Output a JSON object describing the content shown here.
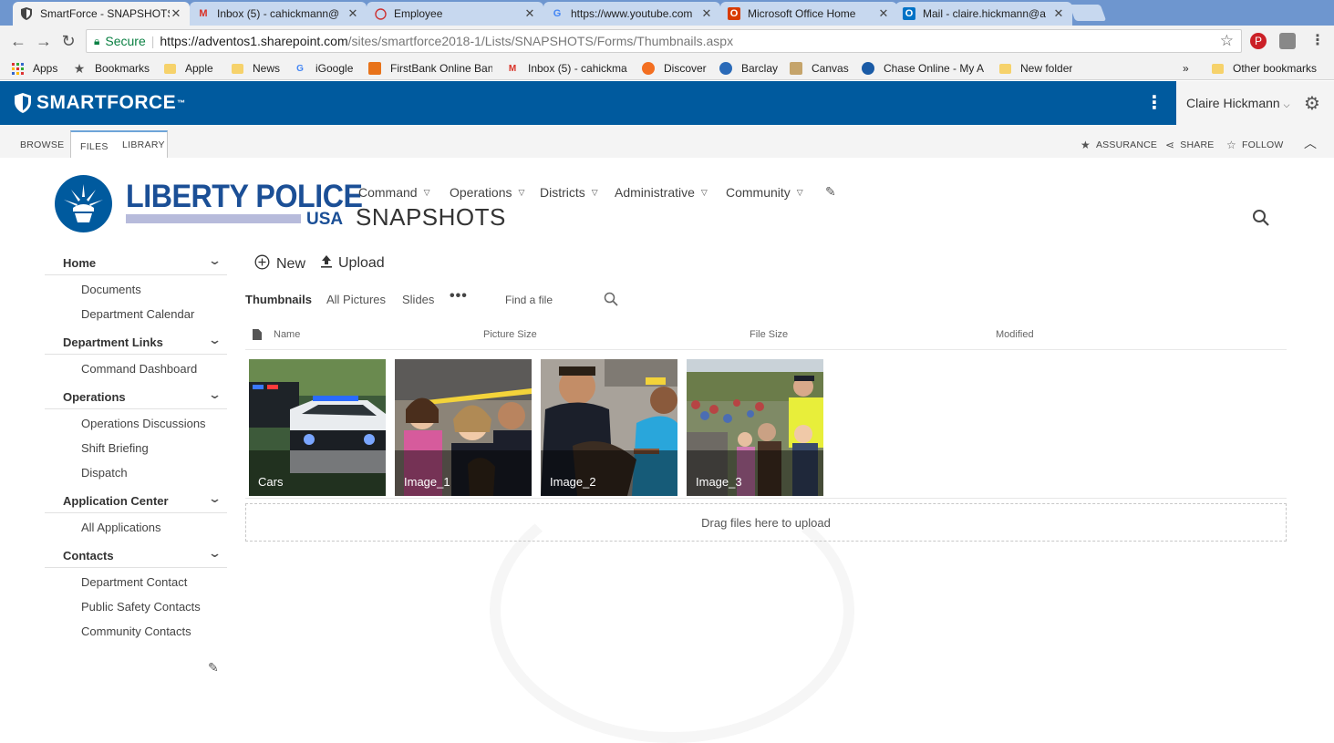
{
  "browser": {
    "tabs": [
      {
        "label": "SmartForce - SNAPSHOTS",
        "icon": "shield-icon",
        "active": true
      },
      {
        "label": "Inbox (5) - cahickmann@",
        "icon": "gmail-icon",
        "active": false
      },
      {
        "label": "Employee",
        "icon": "circle-icon",
        "active": false
      },
      {
        "label": "https://www.youtube.com",
        "icon": "google-icon",
        "active": false
      },
      {
        "label": "Microsoft Office Home",
        "icon": "office-icon",
        "active": false
      },
      {
        "label": "Mail - claire.hickmann@a",
        "icon": "outlook-icon",
        "active": false
      }
    ],
    "close_glyph": "✕",
    "omnibox": {
      "secure_label": "Secure",
      "url_host": "https://adventos1.sharepoint.com",
      "url_path": "/sites/smartforce2018-1/Lists/SNAPSHOTS/Forms/Thumbnails.aspx"
    },
    "bookmarks": [
      {
        "label": "Apps",
        "icon": "apps-grid-icon"
      },
      {
        "label": "Bookmarks",
        "icon": "star-icon"
      },
      {
        "label": "Apple",
        "icon": "folder-icon"
      },
      {
        "label": "News",
        "icon": "folder-icon"
      },
      {
        "label": "iGoogle",
        "icon": "google-icon"
      },
      {
        "label": "FirstBank Online Ban",
        "icon": "bank-icon"
      },
      {
        "label": "Inbox (5) - cahickma",
        "icon": "gmail-icon"
      },
      {
        "label": "Discover",
        "icon": "discover-icon"
      },
      {
        "label": "Barclay",
        "icon": "barclay-icon"
      },
      {
        "label": "Canvas",
        "icon": "canvas-icon"
      },
      {
        "label": "Chase Online - My A",
        "icon": "chase-icon"
      },
      {
        "label": "New folder",
        "icon": "folder-icon"
      }
    ],
    "overflow": "»",
    "other_bookmarks": "Other bookmarks"
  },
  "suite": {
    "brand": "SMARTFORCE",
    "trademark": "™",
    "user": "Claire Hickmann"
  },
  "ribbon": {
    "tabs": [
      "BROWSE",
      "FILES",
      "LIBRARY"
    ],
    "actions": [
      "ASSURANCE",
      "SHARE",
      "FOLLOW"
    ]
  },
  "site": {
    "logo_main": "LIBERTY POLICE",
    "logo_sub": "USA",
    "title": "SNAPSHOTS",
    "topnav": [
      "Command",
      "Operations",
      "Districts",
      "Administrative",
      "Community"
    ]
  },
  "leftnav": [
    {
      "heading": "Home",
      "items": [
        "Documents",
        "Department Calendar"
      ]
    },
    {
      "heading": "Department Links",
      "items": [
        "Command Dashboard"
      ]
    },
    {
      "heading": "Operations",
      "items": [
        "Operations Discussions",
        "Shift Briefing",
        "Dispatch"
      ]
    },
    {
      "heading": "Application Center",
      "items": [
        "All Applications"
      ]
    },
    {
      "heading": "Contacts",
      "items": [
        "Department Contact",
        "Public Safety Contacts",
        "Community Contacts"
      ]
    }
  ],
  "commands": {
    "new": "New",
    "upload": "Upload"
  },
  "views": {
    "items": [
      "Thumbnails",
      "All Pictures",
      "Slides"
    ],
    "more": "•••",
    "find": "Find a file"
  },
  "columns": [
    "Name",
    "Picture Size",
    "File Size",
    "Modified"
  ],
  "thumbnails": [
    "Cars",
    "Image_1",
    "Image_2",
    "Image_3"
  ],
  "dropzone": "Drag files here to upload",
  "colors": {
    "suite_blue": "#005a9e",
    "logo_blue": "#1b4f96",
    "tab_bar": "#6e96cf"
  }
}
